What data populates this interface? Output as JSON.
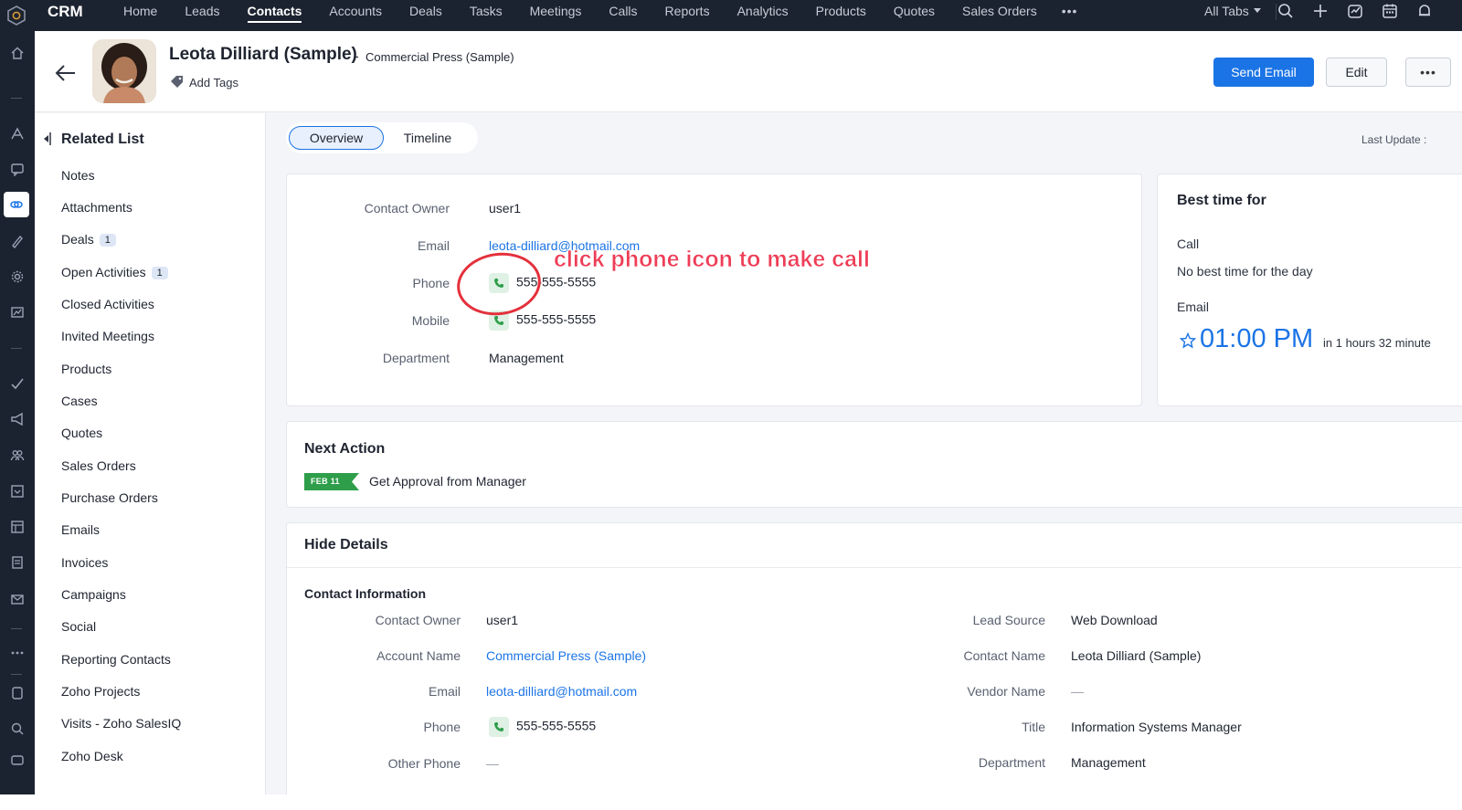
{
  "topbar": {
    "app_name": "CRM",
    "nav": [
      "Home",
      "Leads",
      "Contacts",
      "Accounts",
      "Deals",
      "Tasks",
      "Meetings",
      "Calls",
      "Reports",
      "Analytics",
      "Products",
      "Quotes",
      "Sales Orders"
    ],
    "nav_active": "Contacts",
    "more_label": "•••",
    "all_tabs_label": "All Tabs",
    "icons": [
      "search-icon",
      "plus-icon",
      "activity-icon",
      "calendar-icon",
      "bell-icon"
    ]
  },
  "record": {
    "name": "Leota Dilliard (Sample)",
    "separator": "-",
    "account": "Commercial Press (Sample)",
    "add_tags": "Add Tags",
    "send_email": "Send Email",
    "edit": "Edit",
    "more": "•••"
  },
  "related_list": {
    "title": "Related List",
    "items": [
      {
        "label": "Notes",
        "badge": ""
      },
      {
        "label": "Attachments",
        "badge": ""
      },
      {
        "label": "Deals",
        "badge": "1"
      },
      {
        "label": "Open Activities",
        "badge": "1"
      },
      {
        "label": "Closed Activities",
        "badge": ""
      },
      {
        "label": "Invited Meetings",
        "badge": ""
      },
      {
        "label": "Products",
        "badge": ""
      },
      {
        "label": "Cases",
        "badge": ""
      },
      {
        "label": "Quotes",
        "badge": ""
      },
      {
        "label": "Sales Orders",
        "badge": ""
      },
      {
        "label": "Purchase Orders",
        "badge": ""
      },
      {
        "label": "Emails",
        "badge": ""
      },
      {
        "label": "Invoices",
        "badge": ""
      },
      {
        "label": "Campaigns",
        "badge": ""
      },
      {
        "label": "Social",
        "badge": ""
      },
      {
        "label": "Reporting Contacts",
        "badge": ""
      },
      {
        "label": "Zoho Projects",
        "badge": ""
      },
      {
        "label": "Visits - Zoho SalesIQ",
        "badge": ""
      },
      {
        "label": "Zoho Desk",
        "badge": ""
      }
    ]
  },
  "tabs": {
    "overview": "Overview",
    "timeline": "Timeline"
  },
  "last_update": "Last Update :",
  "summary": {
    "contact_owner_label": "Contact Owner",
    "contact_owner": "user1",
    "email_label": "Email",
    "email": "leota-dilliard@hotmail.com",
    "phone_label": "Phone",
    "phone": "555-555-5555",
    "mobile_label": "Mobile",
    "mobile": "555-555-5555",
    "department_label": "Department",
    "department": "Management"
  },
  "annotation": "click phone icon to make call",
  "best_time": {
    "title": "Best time for",
    "call_label": "Call",
    "call_value": "No best time for the day",
    "email_label": "Email",
    "email_time": "01:00 PM",
    "email_relative": "in 1 hours 32 minute"
  },
  "next_action": {
    "title": "Next Action",
    "date": "FEB 11",
    "task": "Get Approval from Manager"
  },
  "details": {
    "title": "Hide Details",
    "section": "Contact Information",
    "left": [
      {
        "label": "Contact Owner",
        "value": "user1"
      },
      {
        "label": "Account Name",
        "value": "Commercial Press (Sample)"
      },
      {
        "label": "Email",
        "value": "leota-dilliard@hotmail.com"
      },
      {
        "label": "Phone",
        "value": "555-555-5555"
      },
      {
        "label": "Other Phone",
        "value": "—"
      }
    ],
    "right": [
      {
        "label": "Lead Source",
        "value": "Web Download"
      },
      {
        "label": "Contact Name",
        "value": "Leota Dilliard (Sample)"
      },
      {
        "label": "Vendor Name",
        "value": "—"
      },
      {
        "label": "Title",
        "value": "Information Systems Manager"
      },
      {
        "label": "Department",
        "value": "Management"
      }
    ]
  },
  "colors": {
    "accent": "#1b74e6",
    "topbar": "#1c2330",
    "annotation": "#e4303c",
    "flag": "#2e9e4a"
  }
}
